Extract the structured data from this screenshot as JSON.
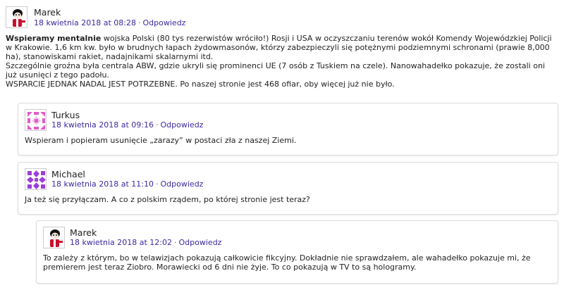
{
  "comments": [
    {
      "author": "Marek",
      "date_link": "18 kwietnia 2018 at 08:28",
      "reply_label": "Odpowiedz",
      "avatar_icon": "cartoon-character-avatar",
      "lead_bold": "Wspieramy mentalnie",
      "body_lines": [
        " wojska Polski (80 tys rezerwistów wróciło!) Rosji i USA w oczyszczaniu terenów wokół Komendy Wojewódzkiej Policji w Krakowie. 1,6 km kw. było w brudnych łapach żydowmasonów, którzy zabezpieczyli się potężnymi podziemnymi schronami (prawie 8,000 ha), stanowiskami rakiet, nadajnikami skalarnymi itd.",
        "Szczególnie groźna była centrala ABW, gdzie ukryli się prominenci UE (7 osób z Tuskiem na czele). Nanowahadełko pokazuje, że zostali oni już usunięci z tego padołu.",
        "WSPARCIE JEDNAK NADAL JEST POTRZEBNE. Po naszej stronie jest 468 ofiar, oby więcej już nie było."
      ]
    },
    {
      "author": "Turkus",
      "date_link": "18 kwietnia 2018 at 09:16",
      "reply_label": "Odpowiedz",
      "avatar_icon": "pink-geometric-identicon",
      "body": "Wspieram i popieram usunięcie „zarazy” w postaci zła z naszej Ziemi."
    },
    {
      "author": "Michael",
      "date_link": "18 kwietnia 2018 at 11:10",
      "reply_label": "Odpowiedz",
      "avatar_icon": "purple-geometric-identicon",
      "body": "Ja też się przyłączam. A co z polskim rządem, po której stronie jest teraz?"
    },
    {
      "author": "Marek",
      "date_link": "18 kwietnia 2018 at 12:02",
      "reply_label": "Odpowiedz",
      "avatar_icon": "cartoon-character-avatar",
      "body": "To zależy z którym, bo w telawizjach pokazują całkowicie fikcyjny. Dokładnie nie sprawdzałem, ale wahadełko pokazuje mi, że premierem jest teraz Ziobro. Morawiecki od 6 dni nie żyje. To co pokazują w TV to są hologramy."
    }
  ],
  "colors": {
    "link": "#3b2aa0",
    "border": "#dcdcdc",
    "identicon_pink": "#e05cc8",
    "identicon_purple": "#9b3fd6"
  }
}
